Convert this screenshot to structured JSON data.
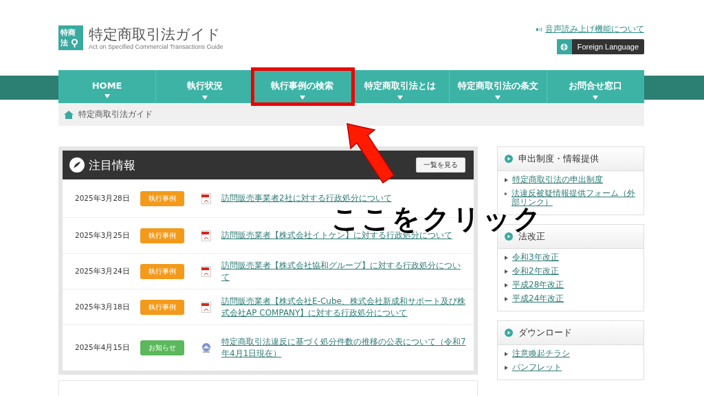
{
  "header": {
    "logo_badge": [
      "特商",
      "法"
    ],
    "title": "特定商取引法ガイド",
    "subtitle": "Act on Specified Commercial Transactions Guide",
    "audio_link": "音声読み上げ機能について",
    "language_button": "Foreign Language"
  },
  "nav": [
    {
      "label": "HOME",
      "annotated": false
    },
    {
      "label": "執行状況",
      "annotated": false
    },
    {
      "label": "執行事例の検索",
      "annotated": true
    },
    {
      "label": "特定商取引法とは",
      "annotated": false
    },
    {
      "label": "特定商取引法の条文",
      "annotated": false
    },
    {
      "label": "お問合せ窓口",
      "annotated": false
    }
  ],
  "breadcrumb": "特定商取引法ガイド",
  "news": {
    "title": "注目情報",
    "list_button": "一覧を見る",
    "items": [
      {
        "date": "2025年3月28日",
        "tag": "執行事例",
        "kind": "pdf",
        "title": "訪問販売事業者2社に対する行政処分について"
      },
      {
        "date": "2025年3月25日",
        "tag": "執行事例",
        "kind": "pdf",
        "title": "訪問販売業者【株式会社イトケン】に対する行政処分について"
      },
      {
        "date": "2025年3月24日",
        "tag": "執行事例",
        "kind": "pdf",
        "title": "訪問販売業者【株式会社協和グループ】に対する行政処分について"
      },
      {
        "date": "2025年3月18日",
        "tag": "執行事例",
        "kind": "pdf",
        "title": "訪問販売業者【株式会社E-Cube、株式会社新成和サポート及び株式会社AP COMPANY】に対する行政処分について"
      },
      {
        "date": "2025年4月15日",
        "tag": "お知らせ",
        "kind": "web",
        "title": "特定商取引法違反に基づく処分件数の推移の公表について（令和7年4月1日現在）"
      }
    ]
  },
  "sidebar": [
    {
      "title": "申出制度・情報提供",
      "links": [
        "特定商取引法の申出制度",
        "法違反被疑情報提供フォーム（外部リンク）"
      ]
    },
    {
      "title": "法改正",
      "links": [
        "令和3年改正",
        "令和2年改正",
        "平成28年改正",
        "平成24年改正"
      ]
    },
    {
      "title": "ダウンロード",
      "links": [
        "注意喚起チラシ",
        "パンフレット"
      ]
    }
  ],
  "annotation": {
    "text": "ここをクリック"
  }
}
